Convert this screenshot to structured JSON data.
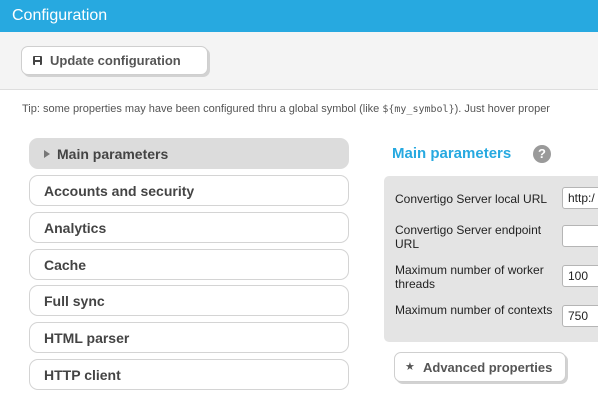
{
  "header": {
    "title": "Configuration"
  },
  "toolbar": {
    "update_label": "Update configuration"
  },
  "tip": {
    "before": "Tip: some properties may have been configured thru a global symbol (like ",
    "code": "${my_symbol}",
    "after": "). Just hover proper"
  },
  "nav": {
    "items": [
      {
        "label": "Main parameters"
      },
      {
        "label": "Accounts and security"
      },
      {
        "label": "Analytics"
      },
      {
        "label": "Cache"
      },
      {
        "label": "Full sync"
      },
      {
        "label": "HTML parser"
      },
      {
        "label": "HTTP client"
      }
    ]
  },
  "section": {
    "title": "Main parameters",
    "help": "?"
  },
  "params": [
    {
      "label": "Convertigo Server local URL",
      "value": "http:/"
    },
    {
      "label": "Convertigo Server endpoint URL",
      "value": ""
    },
    {
      "label": "Maximum number of worker threads",
      "value": "100"
    },
    {
      "label": "Maximum number of contexts",
      "value": "750"
    }
  ],
  "advanced": {
    "label": "Advanced properties",
    "icon": "★"
  },
  "colors": {
    "accent": "#27a9e0",
    "panel": "#e4e4e4"
  }
}
